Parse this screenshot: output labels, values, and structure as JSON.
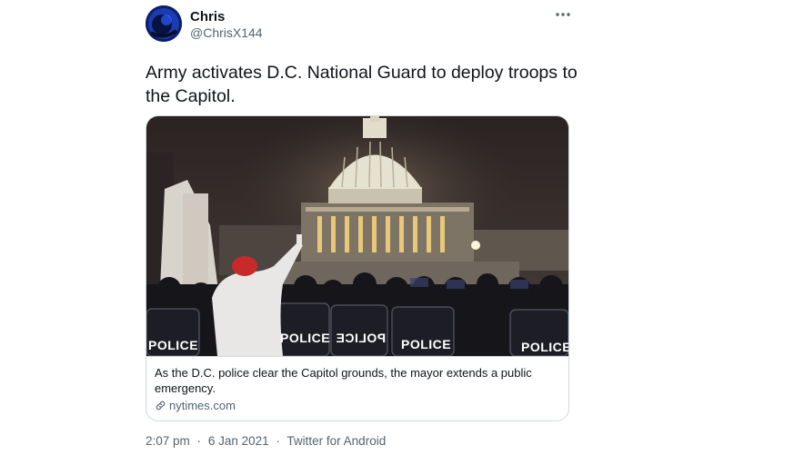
{
  "user": {
    "name": "Chris",
    "handle": "@ChrisX144"
  },
  "tweet": {
    "text": "Army activates D.C. National Guard to deploy troops to the Capitol."
  },
  "card": {
    "description": "As the D.C. police clear the Capitol grounds, the mayor extends a public emergency.",
    "domain": "nytimes.com",
    "shield_text": [
      "POLICE",
      "POLICE",
      "POLICE",
      "POLICE",
      "POLICE"
    ]
  },
  "meta": {
    "time": "2:07 pm",
    "separator": "·",
    "date": "6 Jan 2021",
    "client": "Twitter for Android"
  },
  "colors": {
    "text_primary": "#0f1419",
    "text_secondary": "#536471",
    "border": "#cfd9de"
  }
}
